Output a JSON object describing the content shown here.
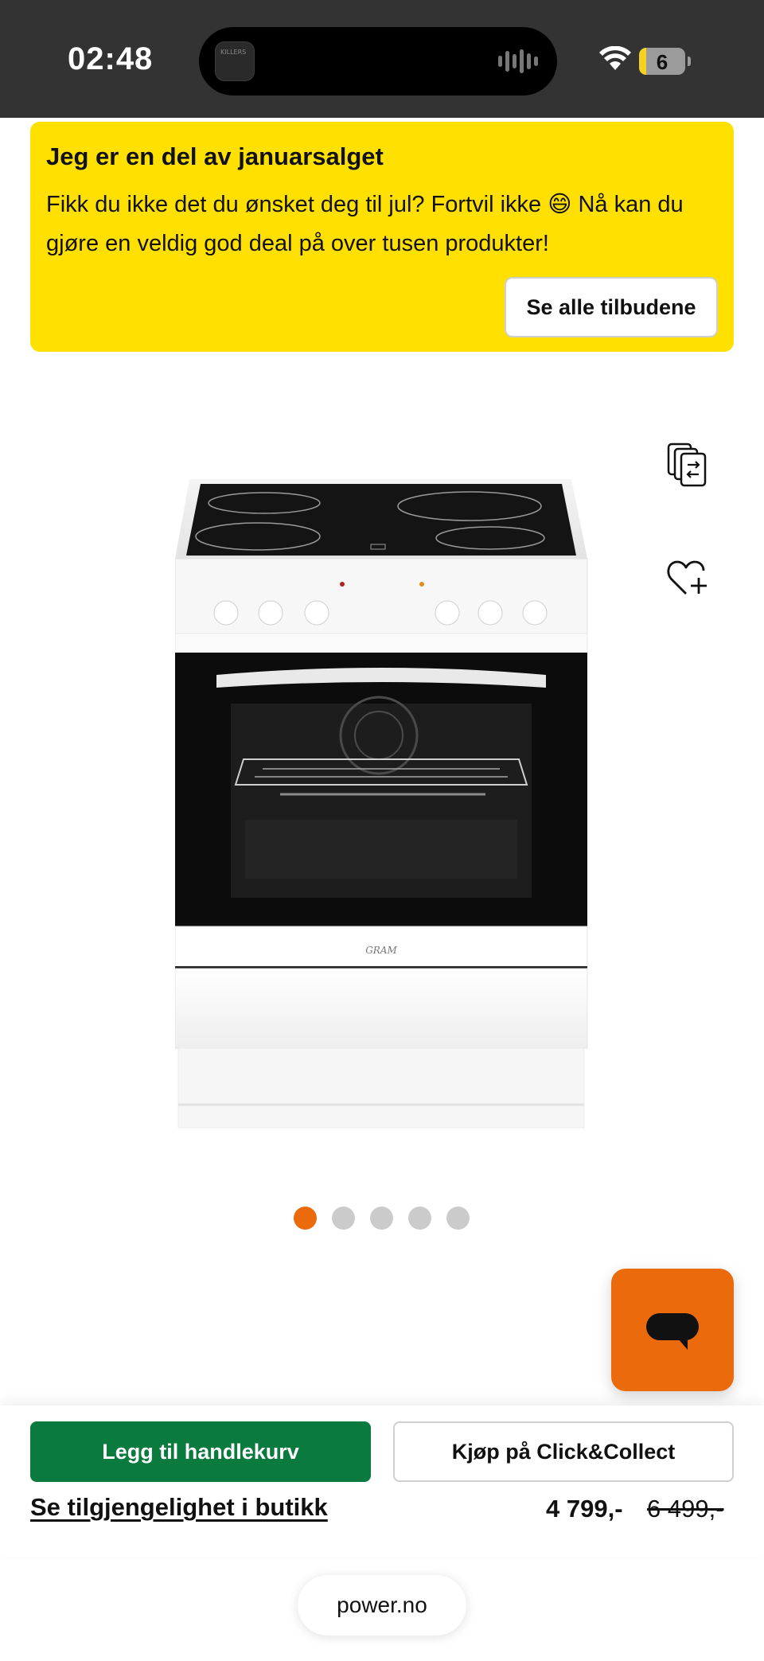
{
  "status_bar": {
    "time": "02:48",
    "island_app_label": "KILLERS",
    "battery_level": "6"
  },
  "promo": {
    "title": "Jeg er en del av januarsalget",
    "text": "Fikk du ikke det du ønsket deg til jul? Fortvil ikke 😄 Nå kan du gjøre en veldig god deal på over tusen produkter!",
    "button_label": "Se alle tilbudene"
  },
  "product": {
    "brand_mark": "GRAM",
    "image_count": 5,
    "active_image_index": 0
  },
  "actions": {
    "add_to_cart_label": "Legg til handlekurv",
    "click_collect_label": "Kjøp på Click&Collect",
    "availability_label": "Se tilgjengelighet i butikk"
  },
  "price": {
    "current": "4 799,-",
    "previous": "6 499,-"
  },
  "browser": {
    "url": "power.no"
  },
  "colors": {
    "promo_background": "#ffe000",
    "accent_orange": "#ea6a0c",
    "cart_green": "#0b7a3f"
  },
  "icons": {
    "compare": "compare-icon",
    "wishlist": "heart-plus-icon",
    "chat": "chat-bubble-icon",
    "wifi": "wifi-icon",
    "battery": "battery-icon"
  }
}
